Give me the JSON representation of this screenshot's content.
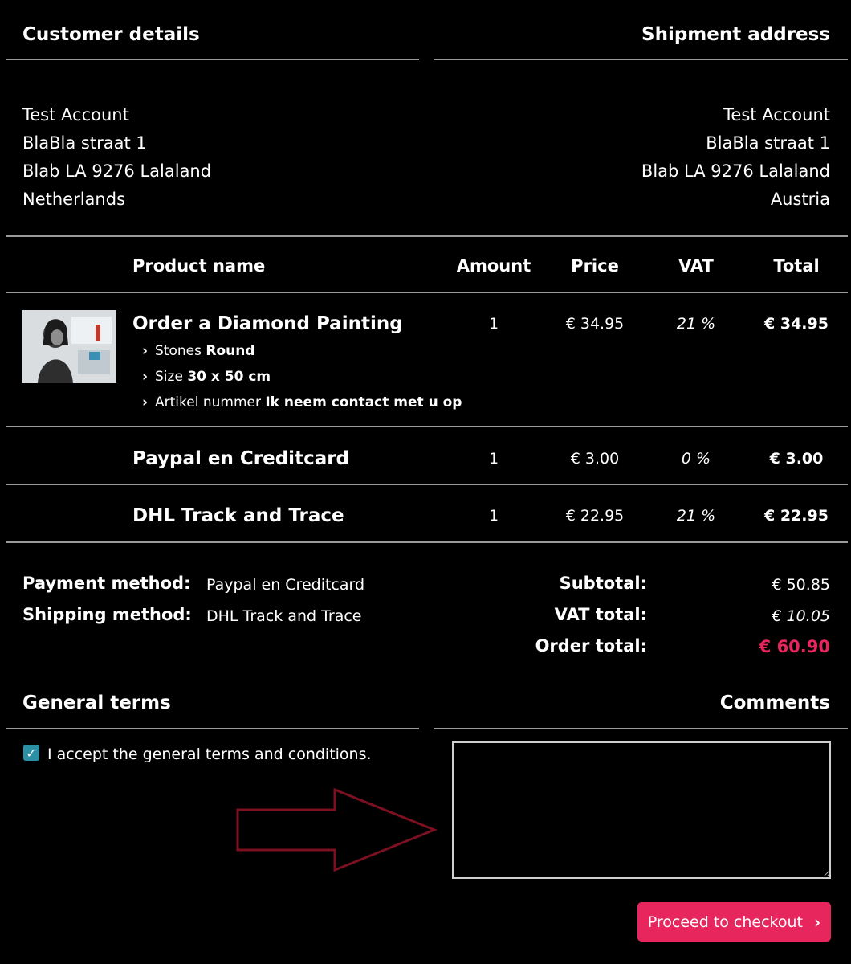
{
  "customer": {
    "heading": "Customer details",
    "lines": [
      "Test Account",
      "BlaBla straat 1",
      "Blab LA 9276 Lalaland",
      "Netherlands"
    ]
  },
  "shipment": {
    "heading": "Shipment address",
    "lines": [
      "Test Account",
      "BlaBla straat 1",
      "Blab LA 9276 Lalaland",
      "Austria"
    ]
  },
  "table": {
    "headers": {
      "product": "Product name",
      "amount": "Amount",
      "price": "Price",
      "vat": "VAT",
      "total": "Total"
    },
    "rows": [
      {
        "name": "Order a Diamond Painting",
        "amount": "1",
        "price": "€ 34.95",
        "vat": "21 %",
        "total": "€ 34.95",
        "options": [
          {
            "label": "Stones",
            "value": "Round"
          },
          {
            "label": "Size",
            "value": "30 x 50 cm"
          },
          {
            "label": "Artikel nummer",
            "value": "Ik neem contact met u op"
          }
        ]
      },
      {
        "name": "Paypal en Creditcard",
        "amount": "1",
        "price": "€ 3.00",
        "vat": "0 %",
        "total": "€ 3.00"
      },
      {
        "name": "DHL Track and Trace",
        "amount": "1",
        "price": "€ 22.95",
        "vat": "21 %",
        "total": "€ 22.95"
      }
    ]
  },
  "summary": {
    "payment_label": "Payment method:",
    "payment_value": "Paypal en Creditcard",
    "shipping_label": "Shipping method:",
    "shipping_value": "DHL Track and Trace",
    "subtotal_label": "Subtotal:",
    "subtotal_value": "€ 50.85",
    "vat_label": "VAT total:",
    "vat_value": "€ 10.05",
    "order_label": "Order total:",
    "order_value": "€ 60.90"
  },
  "terms": {
    "heading": "General terms",
    "checkbox_label": "I accept the general terms and conditions.",
    "checked": true
  },
  "comments": {
    "heading": "Comments",
    "value": ""
  },
  "checkout": {
    "label": "Proceed to checkout",
    "chevron": "›"
  },
  "colors": {
    "accent": "#e8265e",
    "checkbox": "#2b8fa6",
    "arrow": "#7a1020"
  },
  "icons": {
    "chevron": "chevron-right-icon",
    "checkbox": "checkmark-icon",
    "arrow": "arrow-right-annotation"
  }
}
